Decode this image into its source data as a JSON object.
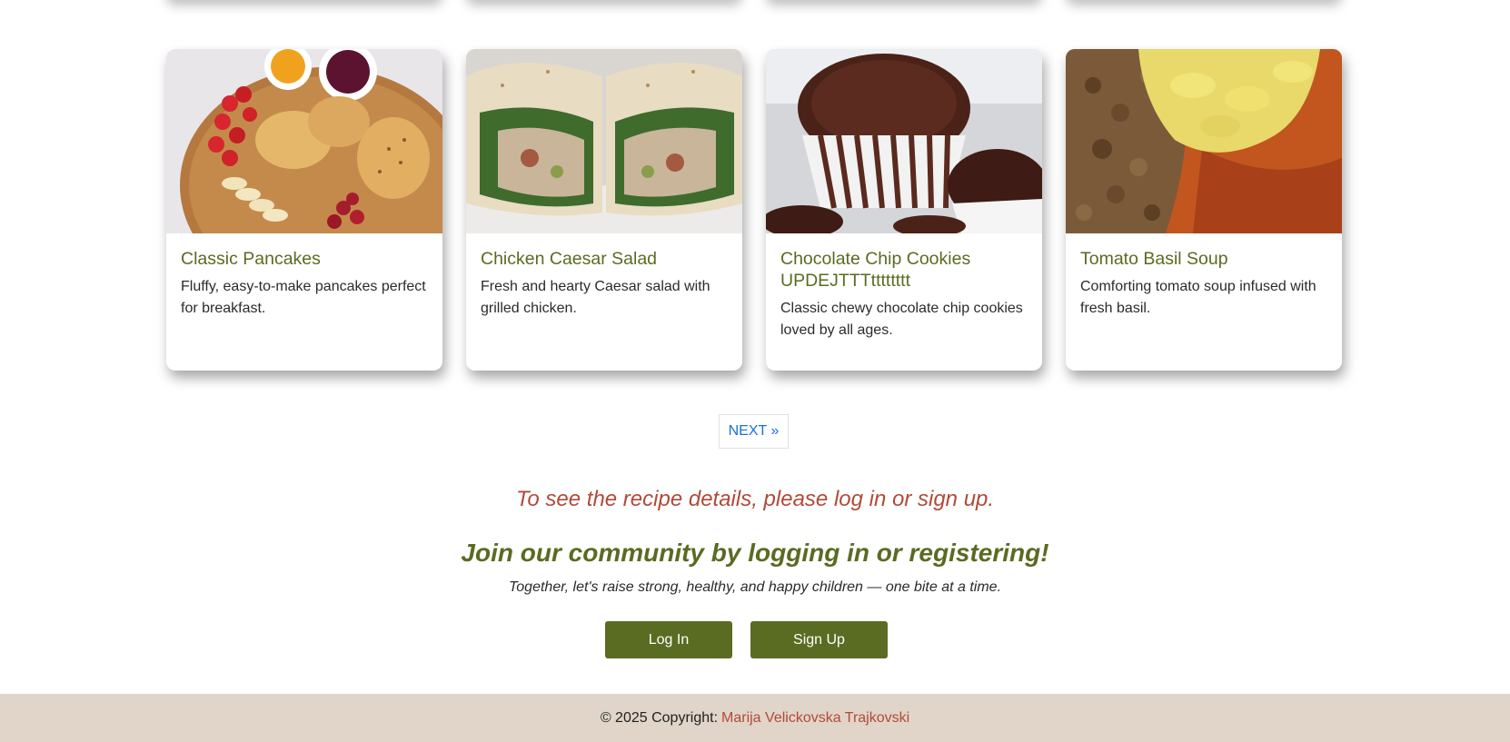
{
  "recipes": [
    {
      "title": "Classic Pancakes",
      "description": "Fluffy, easy-to-make pancakes perfect for breakfast.",
      "image": "pancakes-with-strawberries-photo"
    },
    {
      "title": "Chicken Caesar Salad",
      "description": "Fresh and hearty Caesar salad with grilled chicken.",
      "image": "chicken-wrap-photo"
    },
    {
      "title": "Chocolate Chip Cookies UPDEJTTTtttttttt",
      "description": "Classic chewy chocolate chip cookies loved by all ages.",
      "image": "chocolate-muffins-photo"
    },
    {
      "title": "Tomato Basil Soup",
      "description": "Comforting tomato soup infused with fresh basil.",
      "image": "tomato-stew-with-polenta-photo"
    }
  ],
  "pagination": {
    "next_label": "NEXT »"
  },
  "cta": {
    "notice": "To see the recipe details, please log in or sign up.",
    "heading": "Join our community by logging in or registering!",
    "tagline": "Together, let's raise strong, healthy, and happy children — one bite at a time.",
    "login_label": "Log In",
    "signup_label": "Sign Up"
  },
  "footer": {
    "copyright": "© 2025 Copyright:",
    "author": "Marija Velickovska Trajkovski"
  },
  "colors": {
    "accent_green": "#5a6b22",
    "accent_red": "#b14a38",
    "footer_bg": "#e0d5c8",
    "link_blue": "#1a6fe0"
  }
}
